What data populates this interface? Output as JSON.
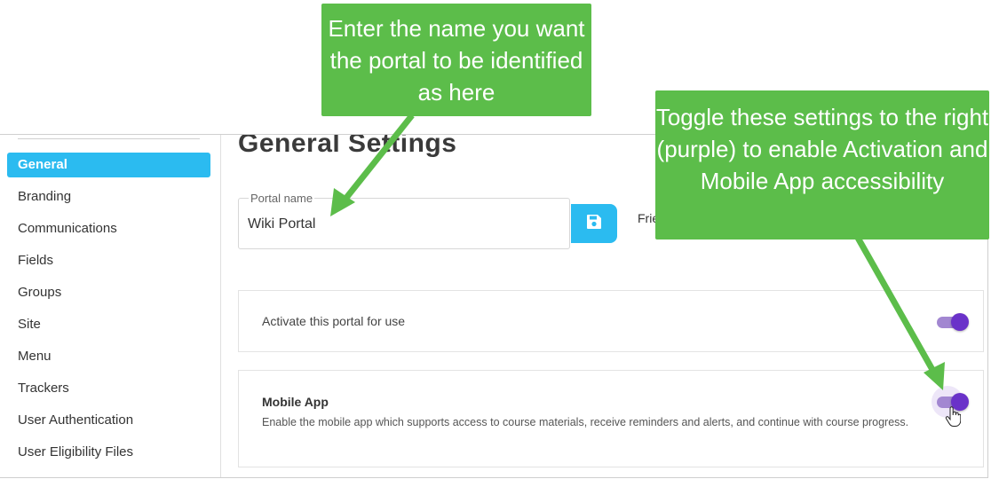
{
  "sidebar": {
    "items": [
      {
        "label": "General",
        "active": true
      },
      {
        "label": "Branding",
        "active": false
      },
      {
        "label": "Communications",
        "active": false
      },
      {
        "label": "Fields",
        "active": false
      },
      {
        "label": "Groups",
        "active": false
      },
      {
        "label": "Site",
        "active": false
      },
      {
        "label": "Menu",
        "active": false
      },
      {
        "label": "Trackers",
        "active": false
      },
      {
        "label": "User Authentication",
        "active": false
      },
      {
        "label": "User Eligibility Files",
        "active": false
      }
    ]
  },
  "main": {
    "title": "General Settings",
    "portal_name": {
      "label": "Portal name",
      "value": "Wiki Portal"
    },
    "save_icon": "floppy-disk-icon",
    "friendly_label_partial": "Frie",
    "activate": {
      "label": "Activate this portal for use",
      "toggle_on": true
    },
    "mobile_app": {
      "title": "Mobile App",
      "description": "Enable the mobile app which supports access to course materials, receive reminders and alerts, and continue with course progress.",
      "toggle_on": true
    }
  },
  "annotations": {
    "left": "Enter the name you want the portal to be identified as here",
    "right": "Toggle these settings to the right (purple) to enable Activation and Mobile App accessibility"
  },
  "colors": {
    "accent_blue": "#2bbbf0",
    "toggle_purple": "#6a32c9",
    "callout_green": "#5cbd4a"
  }
}
